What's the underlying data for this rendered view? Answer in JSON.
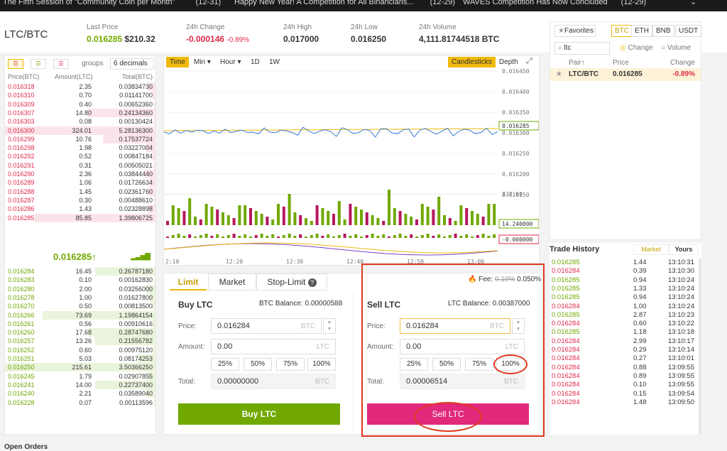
{
  "topbar": {
    "items": [
      {
        "text": "The Fifth Session of \"Community Coin per Month\"",
        "date": "(12-31)"
      },
      {
        "text": "Happy New Year! A Competition for All Binancians...",
        "date": "(12-29)"
      },
      {
        "text": "WAVES Competition Has Now Concluded",
        "date": "(12-29)"
      }
    ]
  },
  "ticker": {
    "pair": "LTC/BTC",
    "last_price_label": "Last Price",
    "last_price": "0.016285",
    "last_price_usd": "$210.32",
    "change_label": "24h Change",
    "change_value": "-0.000146",
    "change_pct": "-0.89%",
    "high_label": "24h High",
    "high_value": "0.017000",
    "low_label": "24h Low",
    "low_value": "0.016250",
    "volume_label": "24h Volume",
    "volume_value": "4,111.81744518 BTC"
  },
  "orderbook": {
    "groups_label": "groups",
    "decimals": "6 decimals",
    "headers": [
      "Price(BTC)",
      "Amount(LTC)",
      "Total(BTC)"
    ],
    "sells": [
      {
        "p": "0.016318",
        "a": "2.35",
        "t": "0.03834730",
        "d": 0.05
      },
      {
        "p": "0.016310",
        "a": "0.70",
        "t": "0.01141700",
        "d": 0.02
      },
      {
        "p": "0.016309",
        "a": "0.40",
        "t": "0.00652360",
        "d": 0.01
      },
      {
        "p": "0.016307",
        "a": "14.80",
        "t": "0.24134360",
        "d": 0.45
      },
      {
        "p": "0.016303",
        "a": "0.08",
        "t": "0.00130424",
        "d": 0.01
      },
      {
        "p": "0.016300",
        "a": "324.01",
        "t": "5.28136300",
        "d": 1.0
      },
      {
        "p": "0.016299",
        "a": "10.76",
        "t": "0.17537724",
        "d": 0.35
      },
      {
        "p": "0.016298",
        "a": "1.98",
        "t": "0.03227004",
        "d": 0.06
      },
      {
        "p": "0.016292",
        "a": "0.52",
        "t": "0.00847184",
        "d": 0.02
      },
      {
        "p": "0.016291",
        "a": "0.31",
        "t": "0.00505021",
        "d": 0.01
      },
      {
        "p": "0.016290",
        "a": "2.36",
        "t": "0.03844440",
        "d": 0.07
      },
      {
        "p": "0.016289",
        "a": "1.06",
        "t": "0.01726634",
        "d": 0.04
      },
      {
        "p": "0.016288",
        "a": "1.45",
        "t": "0.02361760",
        "d": 0.05
      },
      {
        "p": "0.016287",
        "a": "0.30",
        "t": "0.00488610",
        "d": 0.01
      },
      {
        "p": "0.016286",
        "a": "1.43",
        "t": "0.02328898",
        "d": 0.05
      },
      {
        "p": "0.016285",
        "a": "85.85",
        "t": "1.39806725",
        "d": 0.8
      }
    ],
    "current_price": "0.016285↑",
    "buys": [
      {
        "p": "0.016284",
        "a": "16.45",
        "t": "0.26787180",
        "d": 0.4
      },
      {
        "p": "0.016283",
        "a": "0.10",
        "t": "0.00162830",
        "d": 0.01
      },
      {
        "p": "0.016280",
        "a": "2.00",
        "t": "0.03256000",
        "d": 0.06
      },
      {
        "p": "0.016278",
        "a": "1.00",
        "t": "0.01627800",
        "d": 0.04
      },
      {
        "p": "0.016270",
        "a": "0.50",
        "t": "0.00813500",
        "d": 0.02
      },
      {
        "p": "0.016266",
        "a": "73.69",
        "t": "1.19864154",
        "d": 0.75
      },
      {
        "p": "0.016261",
        "a": "0.56",
        "t": "0.00910616",
        "d": 0.02
      },
      {
        "p": "0.016260",
        "a": "17.68",
        "t": "0.28747680",
        "d": 0.45
      },
      {
        "p": "0.016257",
        "a": "13.26",
        "t": "0.21556782",
        "d": 0.4
      },
      {
        "p": "0.016252",
        "a": "0.60",
        "t": "0.00975120",
        "d": 0.02
      },
      {
        "p": "0.016251",
        "a": "5.03",
        "t": "0.08174253",
        "d": 0.12
      },
      {
        "p": "0.016250",
        "a": "215.61",
        "t": "3.50366250",
        "d": 1.0
      },
      {
        "p": "0.016245",
        "a": "1.79",
        "t": "0.02907855",
        "d": 0.05
      },
      {
        "p": "0.016241",
        "a": "14.00",
        "t": "0.22737400",
        "d": 0.4
      },
      {
        "p": "0.016240",
        "a": "2.21",
        "t": "0.03589040",
        "d": 0.06
      },
      {
        "p": "0.016228",
        "a": "0.07",
        "t": "0.00113596",
        "d": 0.01
      }
    ]
  },
  "chart": {
    "intervals": [
      "Time",
      "Min",
      "Hour",
      "1D",
      "1W"
    ],
    "active_interval": "Time",
    "view_buttons": [
      "Candlesticks",
      "Depth"
    ],
    "price_ticks": [
      "0.016450",
      "0.016400",
      "0.016350",
      "0.016300",
      "0.016250",
      "0.016200",
      "0.016150"
    ],
    "current_price_tag": "0.016285",
    "volume_tick": "337.60",
    "volume_tag": "14.240000",
    "macd_tag": "-0.000000",
    "time_ticks": [
      "2:10",
      "12:20",
      "12:30",
      "12:40",
      "12:50",
      "13:00"
    ],
    "colors": {
      "up": "#70a800",
      "down": "#b5175f",
      "line": "#3a7bd5",
      "ma": "#f0b90b"
    }
  },
  "order_form": {
    "tabs": [
      "Limit",
      "Market",
      "Stop-Limit"
    ],
    "active_tab": "Limit",
    "fee_label": "Fee:",
    "fee_old": "0.10%",
    "fee_new": "0.050%",
    "buy": {
      "title": "Buy LTC",
      "balance": "BTC Balance: 0.00000588",
      "price_label": "Price:",
      "price": "0.016284",
      "price_unit": "BTC",
      "amount_label": "Amount:",
      "amount": "0.00",
      "amount_unit": "LTC",
      "pcts": [
        "25%",
        "50%",
        "75%",
        "100%"
      ],
      "total_label": "Total:",
      "total": "0.00000000",
      "total_unit": "BTC",
      "button": "Buy LTC"
    },
    "sell": {
      "title": "Sell LTC",
      "balance": "LTC Balance: 0.00387000",
      "price_label": "Price:",
      "price": "0.016284",
      "price_unit": "BTC",
      "amount_label": "Amount:",
      "amount": "0.00",
      "amount_unit": "LTC",
      "pcts": [
        "25%",
        "50%",
        "75%",
        "100%"
      ],
      "total_label": "Total:",
      "total": "0.00006514",
      "total_unit": "BTC",
      "button": "Sell LTC"
    }
  },
  "pairs": {
    "favorites": "Favorites",
    "markets": [
      "BTC",
      "ETH",
      "BNB",
      "USDT"
    ],
    "active_market": "BTC",
    "search_value": "ltc",
    "radio_change": "Change",
    "radio_volume": "Volume",
    "headers": [
      "Pair↑",
      "Price",
      "Change"
    ],
    "rows": [
      {
        "pair": "LTC/BTC",
        "price": "0.016285",
        "change": "-0.89%"
      }
    ]
  },
  "trade_history": {
    "title": "Trade History",
    "tabs": [
      "Market",
      "Yours"
    ],
    "active_tab": "Market",
    "rows": [
      {
        "p": "0.016285",
        "a": "1.44",
        "t": "13:10:31",
        "s": "buy"
      },
      {
        "p": "0.016284",
        "a": "0.39",
        "t": "13:10:30",
        "s": "sell"
      },
      {
        "p": "0.016285",
        "a": "0.94",
        "t": "13:10:24",
        "s": "buy"
      },
      {
        "p": "0.016285",
        "a": "1.33",
        "t": "13:10:24",
        "s": "buy"
      },
      {
        "p": "0.016285",
        "a": "0.94",
        "t": "13:10:24",
        "s": "buy"
      },
      {
        "p": "0.016284",
        "a": "1.00",
        "t": "13:10:24",
        "s": "sell"
      },
      {
        "p": "0.016285",
        "a": "2.87",
        "t": "13:10:23",
        "s": "buy"
      },
      {
        "p": "0.016284",
        "a": "0.60",
        "t": "13:10:22",
        "s": "sell"
      },
      {
        "p": "0.016285",
        "a": "1.18",
        "t": "13:10:18",
        "s": "buy"
      },
      {
        "p": "0.016284",
        "a": "2.99",
        "t": "13:10:17",
        "s": "sell"
      },
      {
        "p": "0.016284",
        "a": "0.29",
        "t": "13:10:14",
        "s": "sell"
      },
      {
        "p": "0.016284",
        "a": "0.27",
        "t": "13:10:01",
        "s": "sell"
      },
      {
        "p": "0.016284",
        "a": "0.88",
        "t": "13:09:55",
        "s": "sell"
      },
      {
        "p": "0.016284",
        "a": "0.89",
        "t": "13:09:55",
        "s": "sell"
      },
      {
        "p": "0.016284",
        "a": "0.10",
        "t": "13:09:55",
        "s": "sell"
      },
      {
        "p": "0.016284",
        "a": "0.15",
        "t": "13:09:54",
        "s": "sell"
      },
      {
        "p": "0.016284",
        "a": "1.48",
        "t": "13:09:50",
        "s": "sell"
      }
    ]
  }
}
